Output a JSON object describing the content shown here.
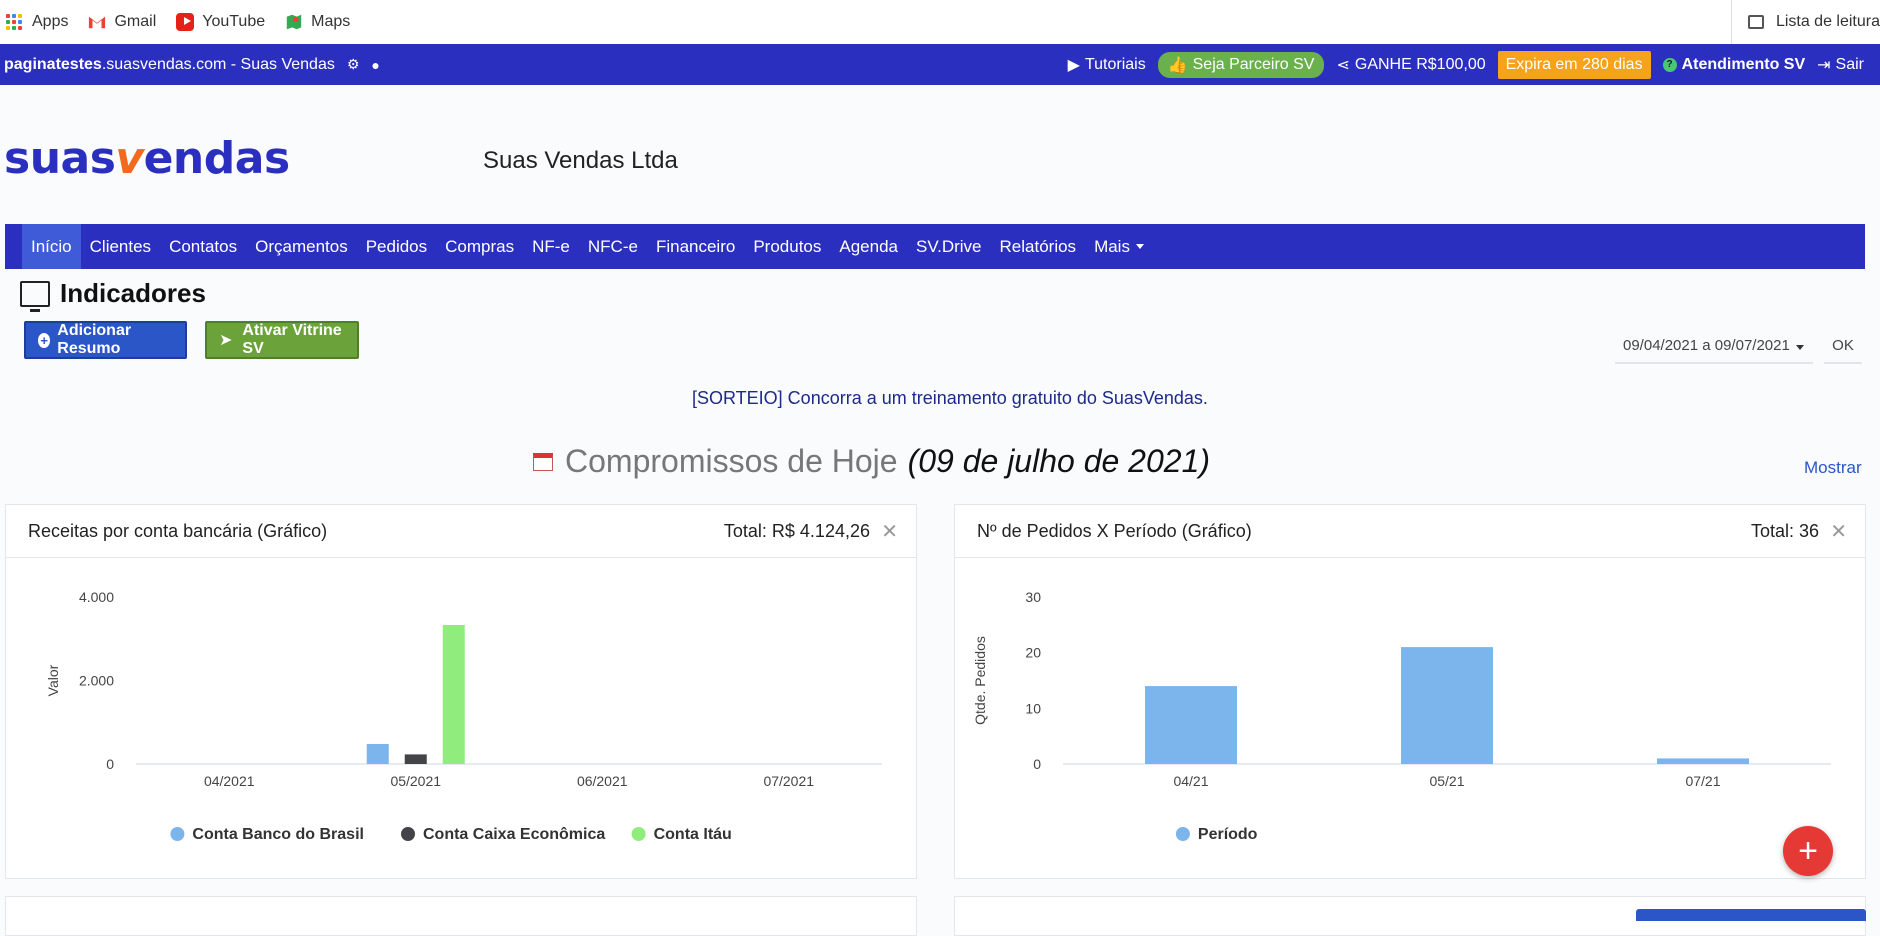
{
  "bookmarks": {
    "items": [
      {
        "label": "Apps",
        "icon": "apps-grid-icon"
      },
      {
        "label": "Gmail",
        "icon": "gmail-icon"
      },
      {
        "label": "YouTube",
        "icon": "youtube-icon"
      },
      {
        "label": "Maps",
        "icon": "maps-icon"
      }
    ],
    "reading_list": "Lista de leitura"
  },
  "topbar": {
    "site_bold": "paginatestes",
    "site_rest": ".suasvendas.com - Suas Vendas",
    "tutoriais": "Tutoriais",
    "parceiro": "Seja Parceiro SV",
    "ganhe": "GANHE R$100,00",
    "expira": "Expira em 280 dias",
    "atendimento": "Atendimento SV",
    "sair": "Sair"
  },
  "header": {
    "logo_part1": "suas",
    "logo_v": "v",
    "logo_part2": "endas",
    "company": "Suas Vendas Ltda"
  },
  "nav": {
    "items": [
      "Início",
      "Clientes",
      "Contatos",
      "Orçamentos",
      "Pedidos",
      "Compras",
      "NF-e",
      "NFC-e",
      "Financeiro",
      "Produtos",
      "Agenda",
      "SV.Drive",
      "Relatórios",
      "Mais"
    ]
  },
  "page": {
    "title": "Indicadores",
    "add_resumo": "Adicionar Resumo",
    "ativar_vitrine": "Ativar Vitrine SV",
    "daterange": "09/04/2021 a 09/07/2021",
    "ok": "OK",
    "sorteio": "[SORTEIO] Concorra a um treinamento gratuito do SuasVendas.",
    "compromissos_label": "Compromissos de Hoje",
    "compromissos_date": "(09 de julho de 2021)",
    "mostrar": "Mostrar"
  },
  "cards": {
    "left": {
      "title": "Receitas por conta bancária (Gráfico)",
      "total": "Total: R$ 4.124,26"
    },
    "right": {
      "title": "Nº de Pedidos X Período (Gráfico)",
      "total": "Total: 36"
    }
  },
  "colors": {
    "brand_blue": "#2b2fbf",
    "accent_orange": "#f26a1b",
    "bar_blue": "#7cb5ec",
    "bar_dark": "#434348",
    "bar_green": "#90ed7d"
  },
  "chart_data": [
    {
      "type": "bar",
      "title": "Receitas por conta bancária (Gráfico)",
      "ylabel": "Valor",
      "categories": [
        "04/2021",
        "05/2021",
        "06/2021",
        "07/2021"
      ],
      "ylim": [
        0,
        4000
      ],
      "yticks": [
        "0",
        "2.000",
        "4.000"
      ],
      "series": [
        {
          "name": "Conta Banco do Brasil",
          "color": "#7cb5ec",
          "values": [
            0,
            480,
            0,
            0
          ]
        },
        {
          "name": "Conta Caixa Econômica",
          "color": "#434348",
          "values": [
            0,
            230,
            0,
            0
          ]
        },
        {
          "name": "Conta Itáu",
          "color": "#90ed7d",
          "values": [
            0,
            3330,
            0,
            0
          ]
        }
      ],
      "legend": "bottom"
    },
    {
      "type": "bar",
      "title": "Nº de Pedidos X Período (Gráfico)",
      "ylabel": "Qtde. Pedidos",
      "categories": [
        "04/21",
        "05/21",
        "07/21"
      ],
      "ylim": [
        0,
        30
      ],
      "yticks": [
        "0",
        "10",
        "20",
        "30"
      ],
      "series": [
        {
          "name": "Período",
          "color": "#7cb5ec",
          "values": [
            14,
            21,
            1
          ]
        }
      ],
      "legend": "bottom"
    }
  ]
}
